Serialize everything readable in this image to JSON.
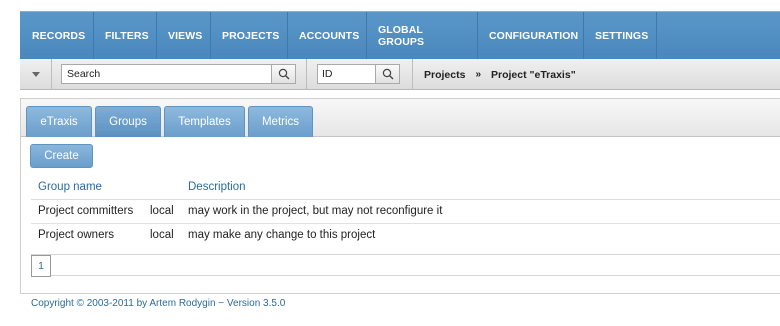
{
  "nav": {
    "items": [
      {
        "label": "RECORDS",
        "w": 74
      },
      {
        "label": "FILTERS",
        "w": 63
      },
      {
        "label": "VIEWS",
        "w": 54
      },
      {
        "label": "PROJECTS",
        "w": 77
      },
      {
        "label": "ACCOUNTS",
        "w": 79
      },
      {
        "label": "GLOBAL GROUPS",
        "w": 111
      },
      {
        "label": "CONFIGURATION",
        "w": 106
      },
      {
        "label": "SETTINGS",
        "w": 73
      }
    ]
  },
  "toolbar": {
    "search_value": "Search",
    "id_value": "ID",
    "breadcrumb": {
      "parent": "Projects",
      "separator": "»",
      "current": "Project \"eTraxis\""
    }
  },
  "tabs": [
    {
      "label": "eTraxis",
      "active": false
    },
    {
      "label": "Groups",
      "active": true
    },
    {
      "label": "Templates",
      "active": false
    },
    {
      "label": "Metrics",
      "active": false
    }
  ],
  "create_label": "Create",
  "table": {
    "columns": [
      "Group name",
      "Description"
    ],
    "rows": [
      {
        "name": "Project committers",
        "scope": "local",
        "description": "may work in the project, but may not reconfigure it"
      },
      {
        "name": "Project owners",
        "scope": "local",
        "description": "may make any change to this project"
      }
    ]
  },
  "pager": {
    "current_page": "1"
  },
  "footer": "Copyright © 2003-2011 by Artem Rodygin − Version 3.5.0",
  "colors": {
    "nav_bg": "#4a87bc",
    "tab_bg": "#6a9ecb",
    "link": "#2c6a9e"
  }
}
